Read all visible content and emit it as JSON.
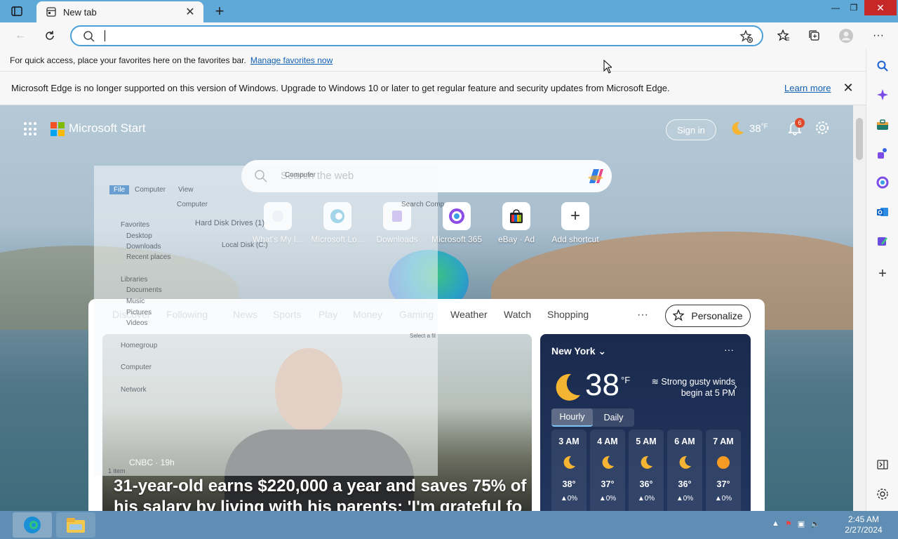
{
  "browser": {
    "tab_title": "New tab",
    "favorites_bar_text": "For quick access, place your favorites here on the favorites bar.",
    "favorites_bar_link": "Manage favorites now",
    "info_text": "Microsoft Edge is no longer supported on this version of Windows. Upgrade to Windows 10 or later to get regular feature and security updates from Microsoft Edge.",
    "info_link": "Learn more",
    "address_value": ""
  },
  "start": {
    "brand": "Microsoft Start",
    "sign_in": "Sign in",
    "header_temp": "38",
    "header_unit": "°F",
    "notifications": "6",
    "search_placeholder": "Search the web",
    "tiles": [
      {
        "label": "What's My I..."
      },
      {
        "label": "Microsoft Lo..."
      },
      {
        "label": "Downloads"
      },
      {
        "label": "Microsoft 365"
      },
      {
        "label": "eBay · Ad"
      },
      {
        "label": "Add shortcut"
      }
    ]
  },
  "feed": {
    "nav": [
      "Discover",
      "Following",
      "News",
      "Sports",
      "Play",
      "Money",
      "Gaming",
      "Weather",
      "Watch",
      "Shopping"
    ],
    "more": "···",
    "personalize": "Personalize",
    "story": {
      "source": "CNBC · 19h",
      "title": "31-year-old earns $220,000 a year and saves 75% of his salary by living with his parents: 'I'm grateful fo"
    }
  },
  "weather": {
    "city": "New York",
    "more": "···",
    "temp": "38",
    "unit": "°F",
    "condition": "Strong gusty winds begin at 5 PM",
    "tabs": [
      "Hourly",
      "Daily"
    ],
    "hours": [
      {
        "time": "3 AM",
        "temp": "38°",
        "precip": "▲0%",
        "icon": "moon-icon"
      },
      {
        "time": "4 AM",
        "temp": "37°",
        "precip": "▲0%",
        "icon": "moon-icon"
      },
      {
        "time": "5 AM",
        "temp": "36°",
        "precip": "▲0%",
        "icon": "moon-icon"
      },
      {
        "time": "6 AM",
        "temp": "36°",
        "precip": "▲0%",
        "icon": "moon-icon"
      },
      {
        "time": "7 AM",
        "temp": "37°",
        "precip": "▲0%",
        "icon": "sun-icon"
      }
    ]
  },
  "explorer_ghost": {
    "title": "Computer",
    "menu": [
      "File",
      "Computer",
      "View"
    ],
    "path": "Computer",
    "search": "Search Comp",
    "nav": [
      "Favorites",
      "Desktop",
      "Downloads",
      "Recent places",
      "Libraries",
      "Documents",
      "Music",
      "Pictures",
      "Videos",
      "Homegroup",
      "Computer",
      "Network"
    ],
    "section": "Hard Disk Drives (1)",
    "drive": "Local Disk (C:)",
    "status": "1 item",
    "select_hint": "Select a fil"
  },
  "taskbar": {
    "time": "2:45 AM",
    "date": "2/27/2024"
  },
  "colors": {
    "tabstrip": "#5fa9d9",
    "close_button": "#c62828",
    "link": "#0f5fb3",
    "taskbar": "#5f8db3",
    "weather_card": "#1a2a4e"
  }
}
